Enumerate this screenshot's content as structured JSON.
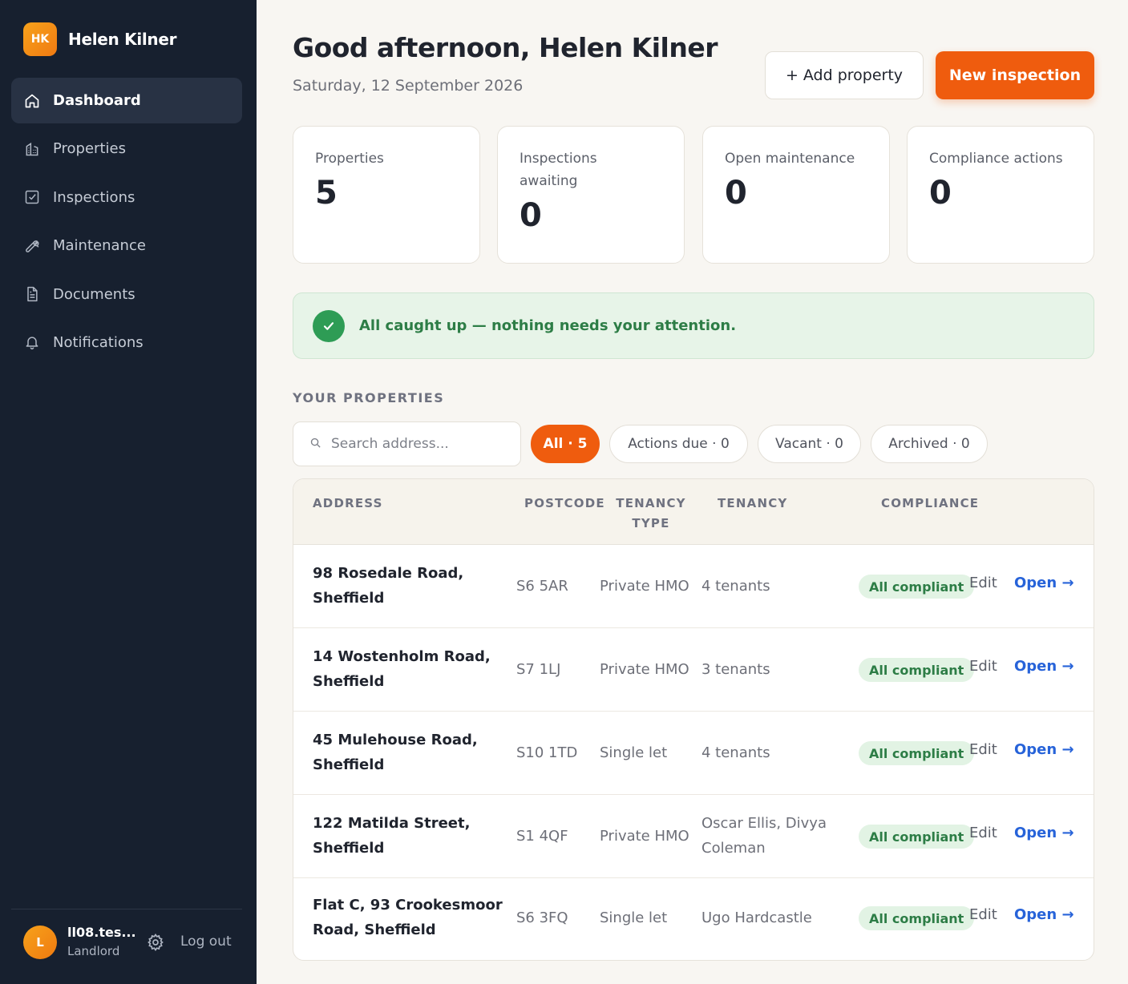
{
  "brand": {
    "initials": "HK",
    "name": "Helen Kilner"
  },
  "nav": [
    {
      "label": "Dashboard",
      "icon": "home-icon",
      "active": true
    },
    {
      "label": "Properties",
      "icon": "building-icon"
    },
    {
      "label": "Inspections",
      "icon": "checkbox-icon"
    },
    {
      "label": "Maintenance",
      "icon": "wrench-icon"
    },
    {
      "label": "Documents",
      "icon": "document-icon"
    },
    {
      "label": "Notifications",
      "icon": "bell-icon"
    }
  ],
  "user": {
    "initial": "L",
    "email": "ll08.tes...",
    "role": "Landlord",
    "logout_label": "Log out"
  },
  "header": {
    "greeting": "Good afternoon, Helen Kilner",
    "date": "Saturday, 12 September 2026",
    "add_property_label": "+ Add property",
    "new_inspection_label": "New inspection"
  },
  "stats": [
    {
      "label": "Properties",
      "value": "5"
    },
    {
      "label": "Inspections awaiting",
      "value": "0"
    },
    {
      "label": "Open maintenance",
      "value": "0"
    },
    {
      "label": "Compliance actions",
      "value": "0"
    }
  ],
  "alert": {
    "text": "All caught up — nothing needs your attention."
  },
  "properties_section": {
    "title": "YOUR PROPERTIES",
    "search_placeholder": "Search address...",
    "filters": [
      "All · 5",
      "Actions due · 0",
      "Vacant · 0",
      "Archived · 0"
    ],
    "columns": [
      "ADDRESS",
      "POSTCODE",
      "TENANCY TYPE",
      "TENANCY",
      "COMPLIANCE"
    ],
    "edit_label": "Edit",
    "open_label": "Open →",
    "rows": [
      {
        "address": "98 Rosedale Road, Sheffield",
        "postcode": "S6 5AR",
        "type": "Private HMO",
        "tenancy": "4 tenants",
        "compliance": "All compliant"
      },
      {
        "address": "14 Wostenholm Road, Sheffield",
        "postcode": "S7 1LJ",
        "type": "Private HMO",
        "tenancy": "3 tenants",
        "compliance": "All compliant"
      },
      {
        "address": "45 Mulehouse Road, Sheffield",
        "postcode": "S10 1TD",
        "type": "Single let",
        "tenancy": "4 tenants",
        "compliance": "All compliant"
      },
      {
        "address": "122 Matilda Street, Sheffield",
        "postcode": "S1 4QF",
        "type": "Private HMO",
        "tenancy": "Oscar Ellis, Divya Coleman",
        "compliance": "All compliant"
      },
      {
        "address": "Flat C, 93 Crookesmoor Road, Sheffield",
        "postcode": "S6 3FQ",
        "type": "Single let",
        "tenancy": "Ugo Hardcastle",
        "compliance": "All compliant"
      }
    ]
  },
  "colors": {
    "sidebar": "#17202f",
    "accent": "#ef5c0e",
    "success": "#2d7d46",
    "link": "#2763d9"
  }
}
